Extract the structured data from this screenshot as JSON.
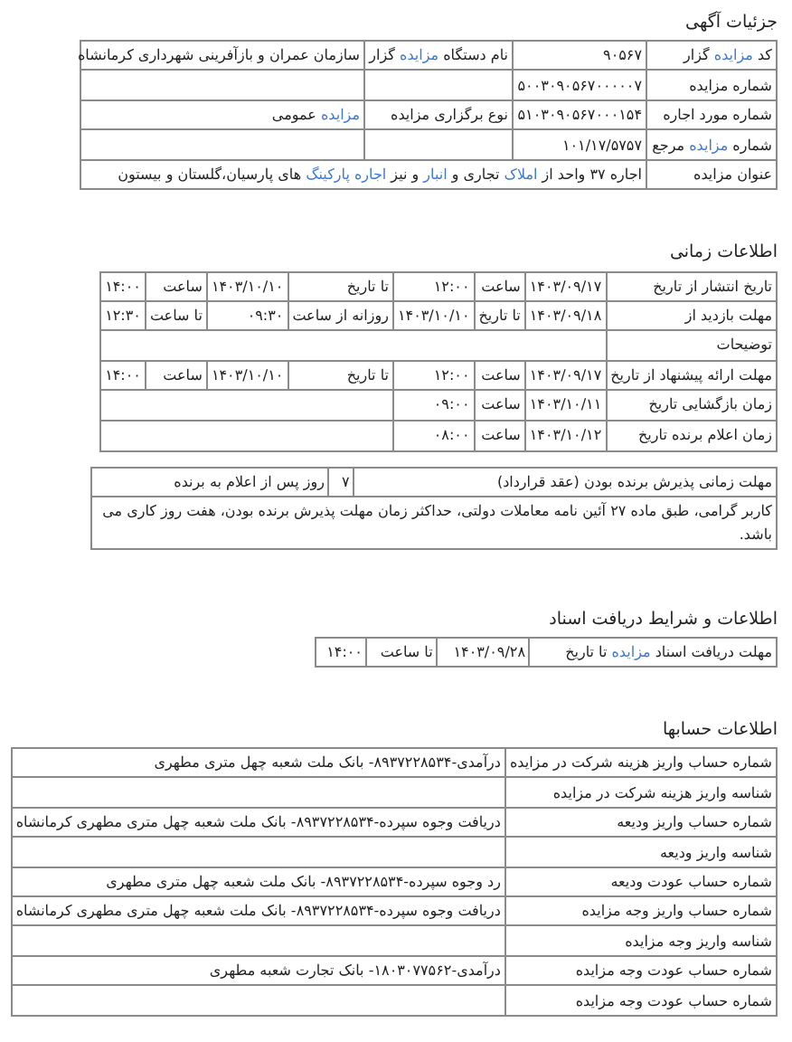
{
  "sections": [
    {
      "title": "جزئیات آگهی",
      "table": {
        "rows": [
          [
            {
              "parts": [
                {
                  "text": "کد ",
                  "link": false
                },
                {
                  "text": "مزایده",
                  "link": true
                },
                {
                  "text": " گزار",
                  "link": false
                }
              ]
            },
            {
              "text": "۹۰۵۶۷"
            },
            {
              "parts": [
                {
                  "text": "نام دستگاه ",
                  "link": false
                },
                {
                  "text": "مزایده",
                  "link": true
                },
                {
                  "text": " گزار",
                  "link": false
                }
              ]
            },
            {
              "text": "سازمان عمران و بازآفرینی شهرداری کرمانشاه"
            }
          ],
          [
            {
              "text": "شماره مزایده"
            },
            {
              "text": "۵۰۰۳۰۹۰۵۶۷۰۰۰۰۰۷"
            },
            {},
            {}
          ],
          [
            {
              "text": "شماره مورد اجاره"
            },
            {
              "text": "۵۱۰۳۰۹۰۵۶۷۰۰۰۱۵۴"
            },
            {
              "text": "نوع برگزاری مزایده"
            },
            {
              "parts": [
                {
                  "text": "مزایده",
                  "link": true
                },
                {
                  "text": " عمومی",
                  "link": false
                }
              ]
            }
          ],
          [
            {
              "parts": [
                {
                  "text": "شماره ",
                  "link": false
                },
                {
                  "text": "مزایده",
                  "link": true
                },
                {
                  "text": " مرجع",
                  "link": false
                }
              ]
            },
            {
              "text": "۱۰۱/۱۷/۵۷۵۷"
            },
            {},
            {}
          ]
        ]
      },
      "subject": {
        "label": "عنوان مزایده",
        "parts": [
          {
            "text": "اجاره ۳۷ واحد از ",
            "link": false
          },
          {
            "text": "املاک",
            "link": true
          },
          {
            "text": " تجاری و ",
            "link": false
          },
          {
            "text": "انبار",
            "link": true
          },
          {
            "text": " و نیز ",
            "link": false
          },
          {
            "text": "اجاره پارکینگ",
            "link": true
          },
          {
            "text": " های پارسیان،گلستان و بیستون",
            "link": false
          }
        ]
      }
    },
    {
      "title": "اطلاعات زمانی",
      "table": {
        "rows": [
          [
            {
              "text": "تاریخ انتشار از تاریخ"
            },
            {
              "text": "۱۴۰۳/۰۹/۱۷"
            },
            {
              "text": "ساعت"
            },
            {
              "text": "۱۲:۰۰"
            },
            {
              "text": "تا تاریخ"
            },
            {
              "text": "۱۴۰۳/۱۰/۱۰"
            },
            {
              "text": "ساعت"
            },
            {
              "text": "۱۴:۰۰"
            }
          ],
          [
            {
              "text": "مهلت بازدید از"
            },
            {
              "text": "۱۴۰۳/۰۹/۱۸"
            },
            {
              "text": "تا تاریخ"
            },
            {
              "text": "۱۴۰۳/۱۰/۱۰"
            },
            {
              "text": "روزانه از ساعت"
            },
            {
              "text": "۰۹:۳۰"
            },
            {
              "text": "تا ساعت"
            },
            {
              "text": "۱۲:۳۰"
            }
          ],
          [
            {
              "text": "توضیحات"
            },
            {}
          ],
          [
            {
              "text": "مهلت ارائه پیشنهاد از تاریخ"
            },
            {
              "text": "۱۴۰۳/۰۹/۱۷"
            },
            {
              "text": "ساعت"
            },
            {
              "text": "۱۲:۰۰"
            },
            {
              "text": "تا تاریخ"
            },
            {
              "text": "۱۴۰۳/۱۰/۱۰"
            },
            {
              "text": "ساعت"
            },
            {
              "text": "۱۴:۰۰"
            }
          ],
          [
            {
              "text": "زمان بازگشایی تاریخ"
            },
            {
              "text": "۱۴۰۳/۱۰/۱۱"
            },
            {
              "text": "ساعت"
            },
            {
              "text": "۰۹:۰۰"
            },
            {}
          ],
          [
            {
              "text": "زمان اعلام برنده تاریخ"
            },
            {
              "text": "۱۴۰۳/۱۰/۱۲"
            },
            {
              "text": "ساعت"
            },
            {
              "text": "۰۸:۰۰"
            },
            {}
          ]
        ]
      }
    },
    {
      "table": {
        "rows": [
          [
            {
              "text": "مهلت زمانی پذیرش برنده بودن (عقد قرارداد)"
            },
            {
              "text": "۷"
            },
            {
              "text": "روز پس از اعلام به برنده"
            }
          ]
        ]
      },
      "note": "کاربر گرامی، طبق ماده ۲۷ آئین نامه معاملات دولتی، حداکثر زمان مهلت پذیرش برنده بودن، هفت روز کاری می باشد."
    },
    {
      "title": "اطلاعات و شرایط دریافت اسناد",
      "table": {
        "rows": [
          [
            {
              "parts": [
                {
                  "text": "مهلت دریافت اسناد ",
                  "link": false
                },
                {
                  "text": "مزایده",
                  "link": true
                },
                {
                  "text": " تا تاریخ",
                  "link": false
                }
              ]
            },
            {
              "text": "۱۴۰۳/۰۹/۲۸"
            },
            {
              "text": "تا ساعت"
            },
            {
              "text": "۱۴:۰۰"
            }
          ]
        ]
      }
    },
    {
      "title": "اطلاعات حسابها",
      "table": {
        "rows": [
          [
            {
              "text": "شماره حساب واریز هزینه شرکت در مزایده"
            },
            {
              "text": "درآمدی-۸۹۳۷۲۲۸۵۳۴- بانک ملت شعبه چهل متری مطهری"
            }
          ],
          [
            {
              "text": "شناسه واریز هزینه شرکت در مزایده"
            },
            {}
          ],
          [
            {
              "text": "شماره حساب واریز ودیعه"
            },
            {
              "text": "دریافت وجوه سپرده-۸۹۳۷۲۲۸۵۳۴- بانک ملت شعبه چهل متری مطهری کرمانشاه"
            }
          ],
          [
            {
              "text": "شناسه واریز ودیعه"
            },
            {}
          ],
          [
            {
              "text": "شماره حساب عودت ودیعه"
            },
            {
              "text": "رد وجوه سپرده-۸۹۳۷۲۲۸۵۳۴- بانک ملت شعبه چهل متری مطهری"
            }
          ],
          [
            {
              "text": "شماره حساب واریز وجه مزایده"
            },
            {
              "text": "دریافت وجوه سپرده-۸۹۳۷۲۲۸۵۳۴- بانک ملت شعبه چهل متری مطهری کرمانشاه"
            }
          ],
          [
            {
              "text": "شناسه واریز وجه مزایده"
            },
            {}
          ],
          [
            {
              "text": "شماره حساب عودت وجه مزایده"
            },
            {
              "text": "درآمدی-۱۸۰۳۰۷۷۵۶۲- بانک تجارت شعبه مطهری"
            }
          ],
          [
            {
              "text": "شماره حساب عودت وجه مزایده"
            },
            {}
          ]
        ]
      }
    }
  ]
}
